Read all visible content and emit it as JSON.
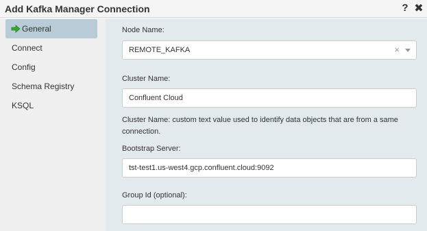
{
  "dialog": {
    "title": "Add Kafka Manager Connection",
    "help_glyph": "?",
    "close_glyph": "✖"
  },
  "sidebar": {
    "items": [
      {
        "label": "General",
        "active": true,
        "icon": "arrow-right-icon"
      },
      {
        "label": "Connect",
        "active": false
      },
      {
        "label": "Config",
        "active": false
      },
      {
        "label": "Schema Registry",
        "active": false
      },
      {
        "label": "KSQL",
        "active": false
      }
    ]
  },
  "form": {
    "node_name_label": "Node Name:",
    "node_name_value": "REMOTE_KAFKA",
    "clear_glyph": "×",
    "cluster_name_label": "Cluster Name:",
    "cluster_name_value": "Confluent Cloud",
    "cluster_name_help": "Cluster Name: custom text value used to identify data objects that are from a same connection.",
    "bootstrap_label": "Bootstrap Server:",
    "bootstrap_value": "tst-test1.us-west4.gcp.confluent.cloud:9092",
    "group_id_label": "Group Id (optional):",
    "group_id_value": ""
  },
  "colors": {
    "sidebar_bg": "#f0f0f0",
    "main_bg": "#e3eaee",
    "active_item_bg": "#b7ccd6",
    "arrow_green": "#3aa635"
  }
}
